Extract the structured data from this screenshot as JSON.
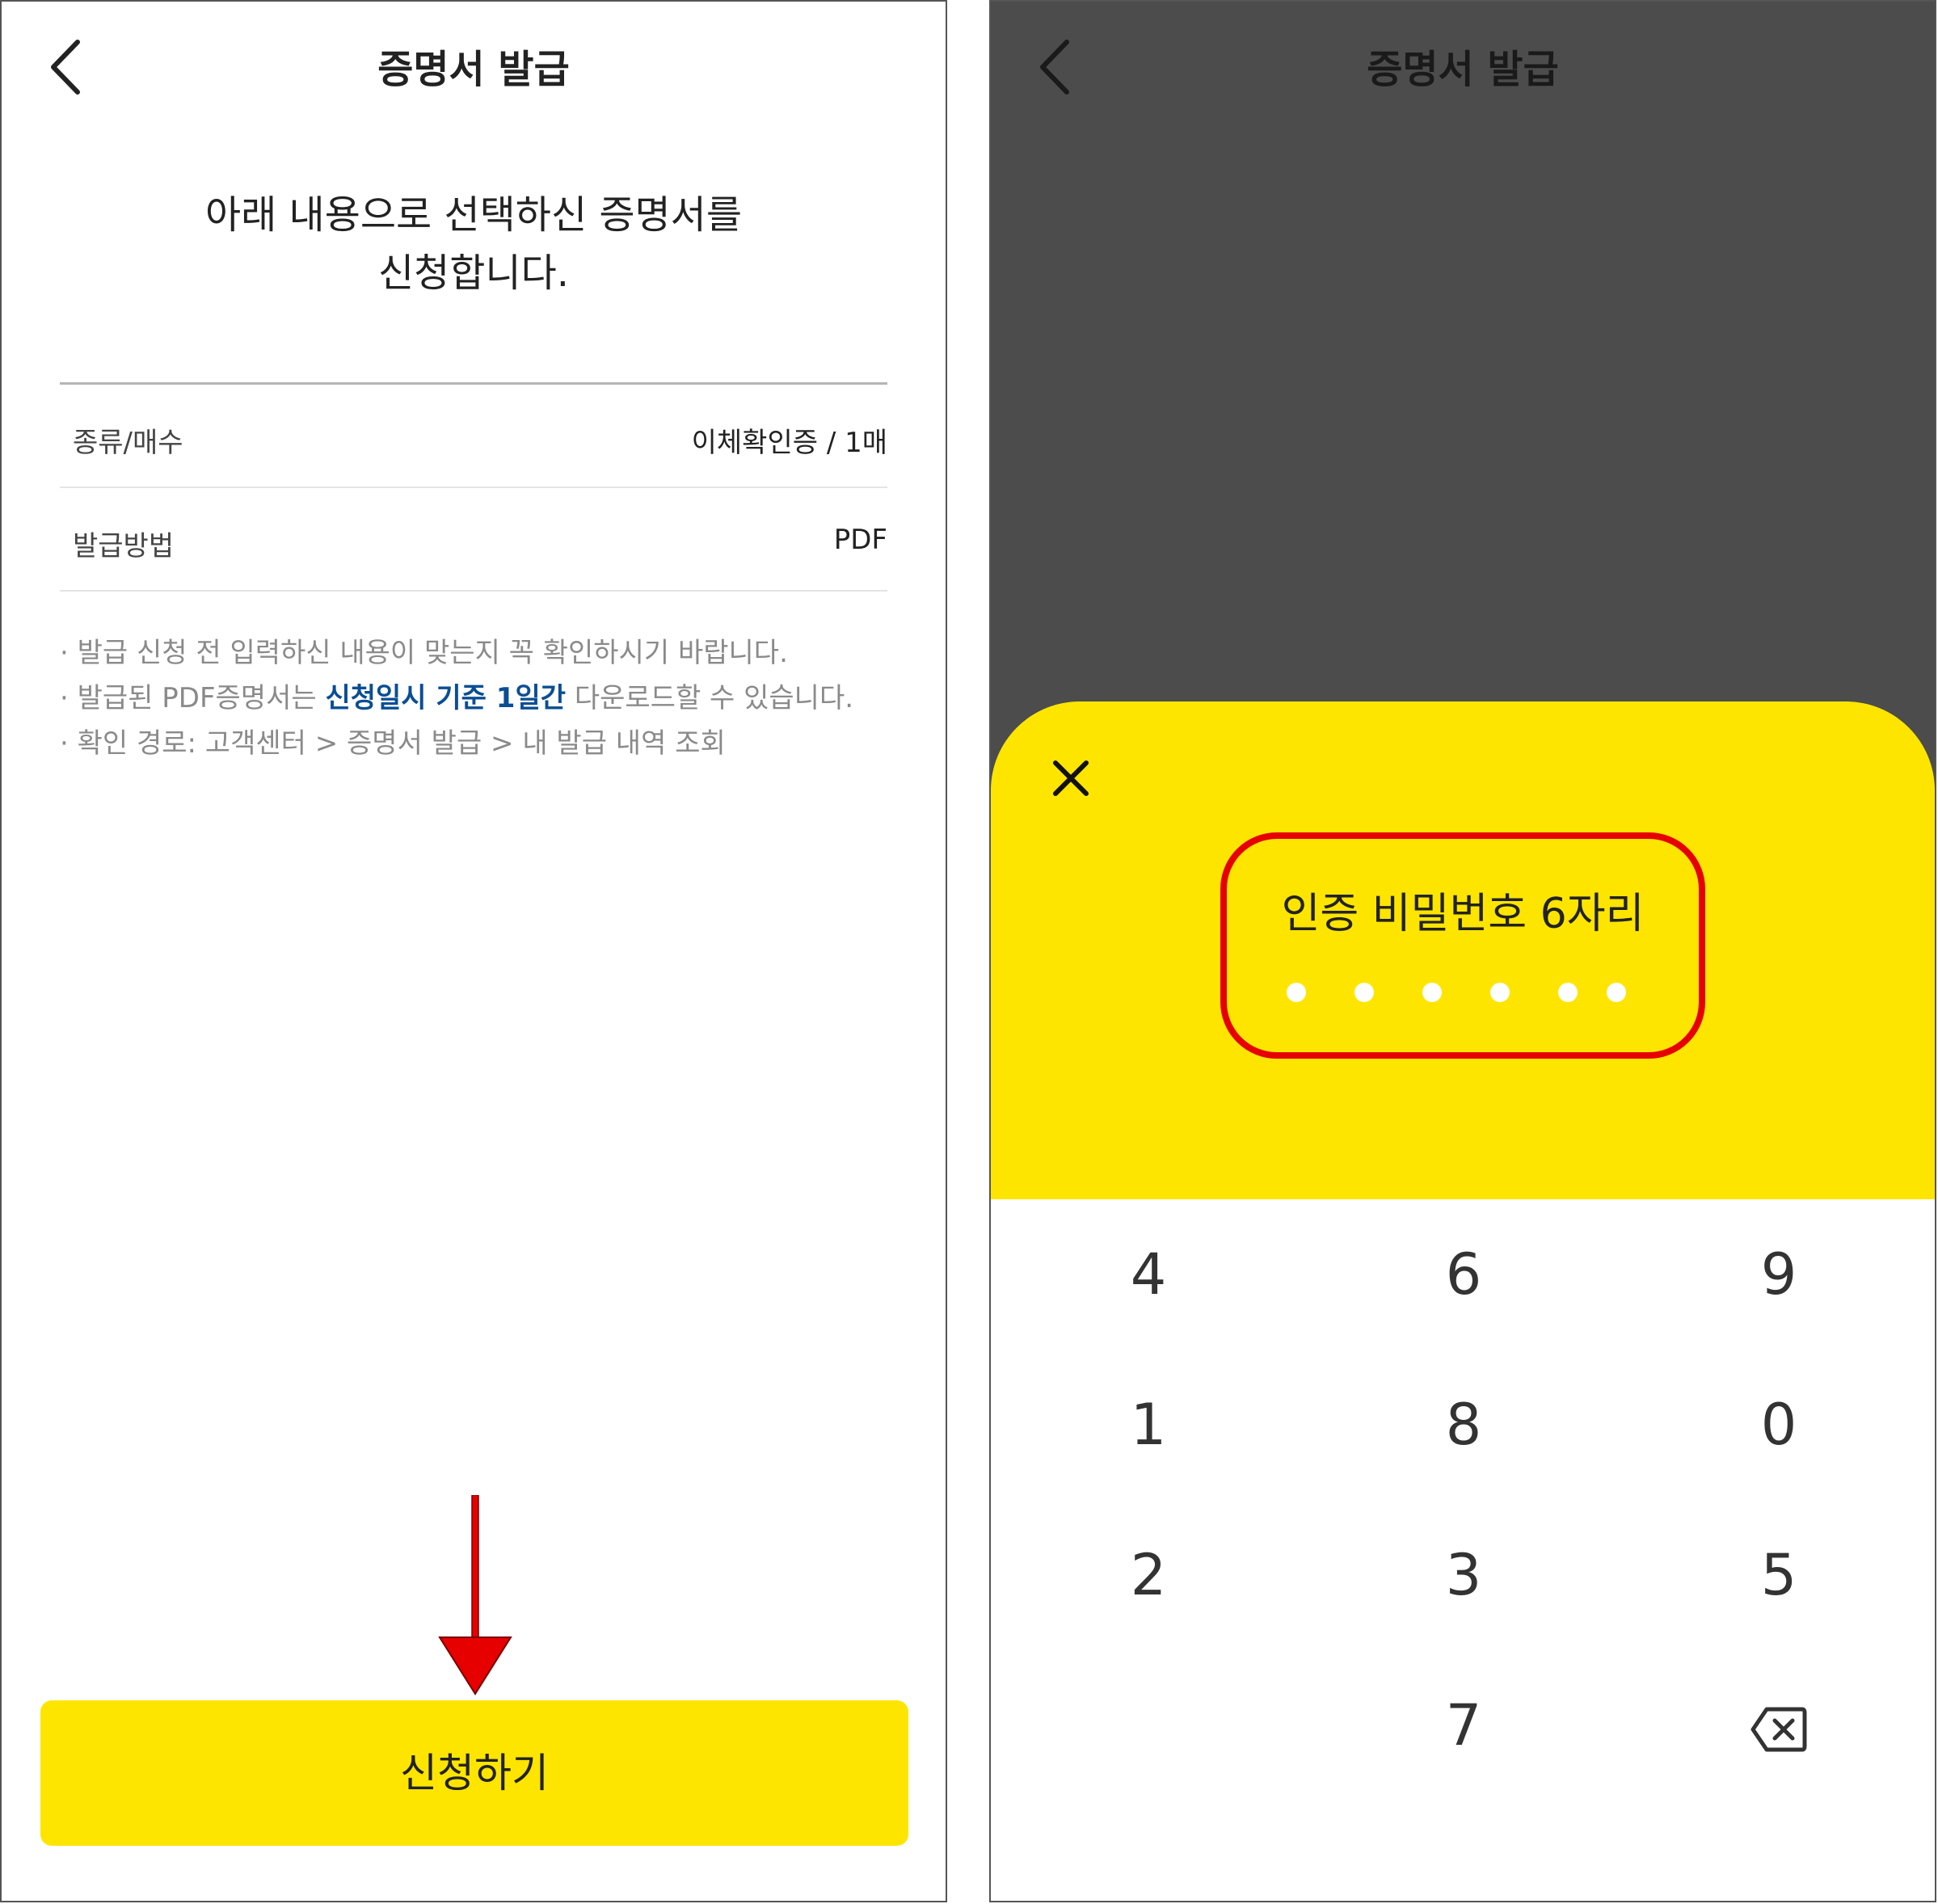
{
  "left_screen": {
    "header": {
      "title": "증명서 발급"
    },
    "intro": {
      "line1": "아래 내용으로 선택하신 증명서를",
      "line2": "신청합니다."
    },
    "rows": [
      {
        "label": "종류/매수",
        "value": "이체확인증 / 1매"
      },
      {
        "label": "발급방법",
        "value": "PDF"
      }
    ],
    "notices": {
      "n1": "· 발급 신청 전 입력하신 내용이 맞는지 꼭 확인하시기 바랍니다.",
      "n2_pre": "· 발급된 PDF증명서는 ",
      "n2_highlight": "신청일시 기준 1일간",
      "n2_post": " 다운로드할 수 있습니다.",
      "n3": "· 확인 경로: 고객센터 > 증명서 발급 > 내 발급 내역 조회"
    },
    "apply_button": "신청하기",
    "colors": {
      "accent": "#fee500",
      "highlight_text": "#0a4e94",
      "annotation": "#e60000"
    }
  },
  "right_screen": {
    "header": {
      "title": "증명서 발급"
    },
    "pin": {
      "title": "인증 비밀번호 6자리",
      "length": 6,
      "entered": 0
    },
    "keypad": {
      "row1": [
        "4",
        "6",
        "9"
      ],
      "row2": [
        "1",
        "8",
        "0"
      ],
      "row3": [
        "2",
        "3",
        "5"
      ],
      "row4": [
        "",
        "7",
        "backspace-icon"
      ]
    },
    "colors": {
      "sheet": "#fee500",
      "overlay": "#4c4c4c",
      "annotation": "#e60000"
    }
  }
}
